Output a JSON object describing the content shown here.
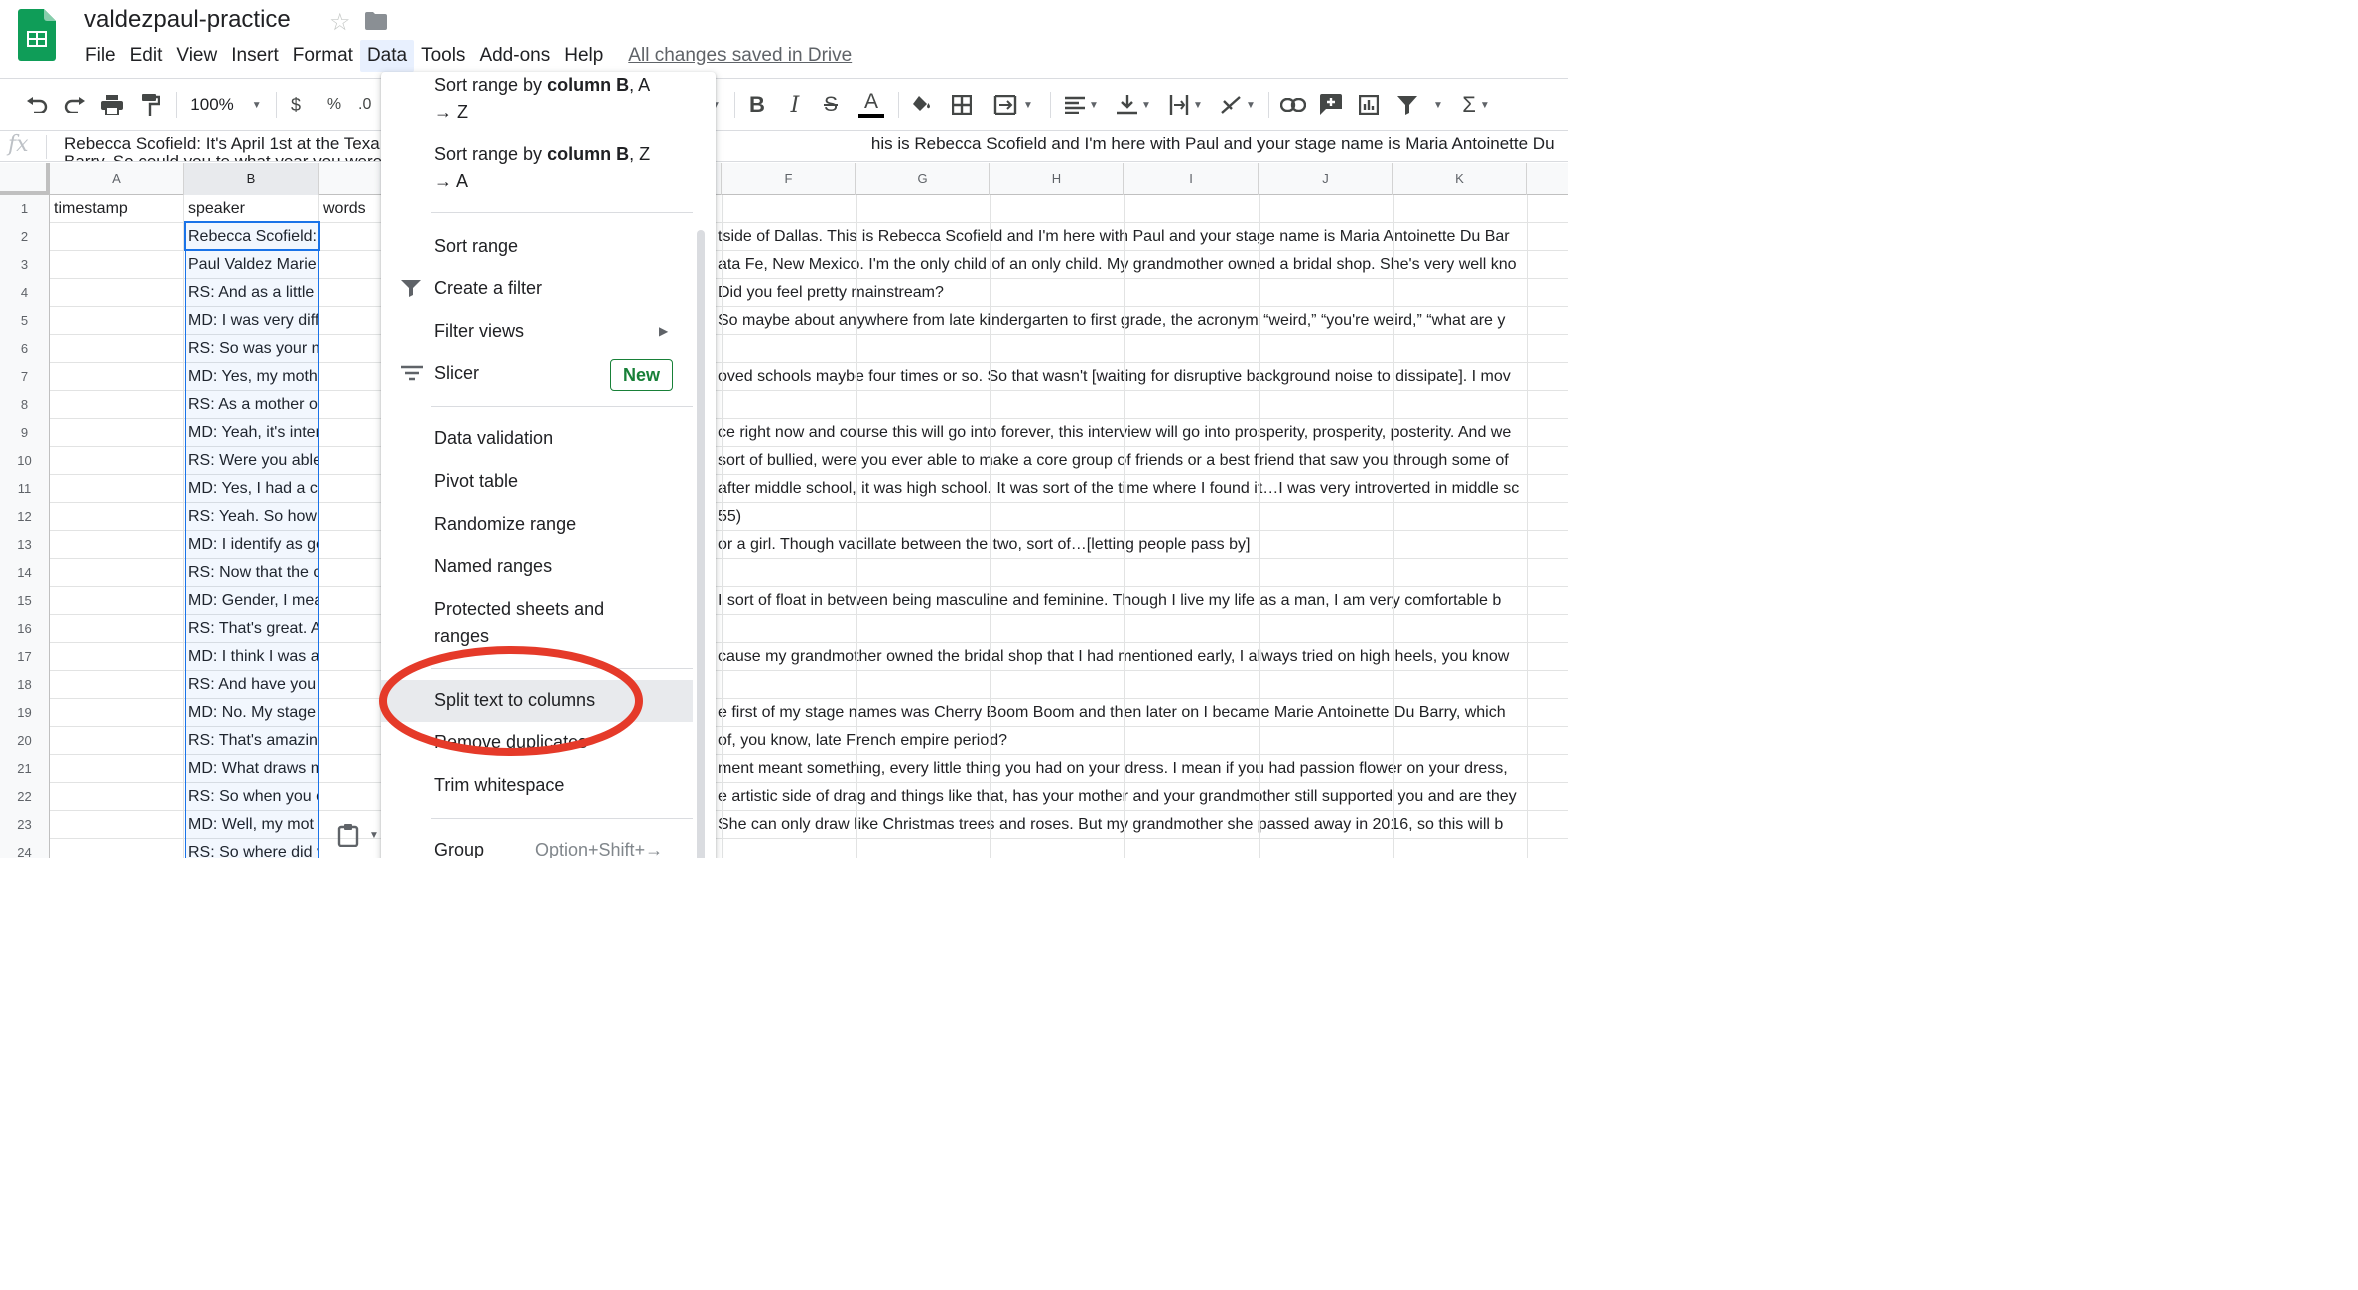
{
  "app": {
    "doc_title": "valdezpaul-practice",
    "saved_status": "All changes saved in Drive"
  },
  "menubar": {
    "items": [
      "File",
      "Edit",
      "View",
      "Insert",
      "Format",
      "Data",
      "Tools",
      "Add-ons",
      "Help"
    ],
    "active": "Data"
  },
  "toolbar": {
    "zoom": "100%",
    "currency": "$",
    "percent": "%",
    "decimal": ".0"
  },
  "formula_bar": {
    "fx": "fx",
    "text": "Rebecca Scofield: It's April 1st at the Texa                                                                                                        his is Rebecca Scofield and I'm here with Paul and your stage name is Maria Antoinette Du Barry. So could you te what year you were born?"
  },
  "columns": [
    "A",
    "B",
    "C",
    "D",
    "E",
    "F",
    "G",
    "H",
    "I",
    "J",
    "K"
  ],
  "rows": [
    {
      "n": "1",
      "a": "timestamp",
      "b": "speaker",
      "c": "words",
      "right": ""
    },
    {
      "n": "2",
      "a": "",
      "b": "Rebecca Scofield: It's Ap",
      "c": "",
      "right": "tside of Dallas. This is Rebecca Scofield and I'm here with Paul and your stage name is Maria Antoinette Du Bar"
    },
    {
      "n": "3",
      "a": "",
      "b": "Paul Valdez Marie Du Ba",
      "c": "",
      "right": "ata Fe, New Mexico. I'm the only child of an only child. My grandmother owned a bridal shop. She's very well kno"
    },
    {
      "n": "4",
      "a": "",
      "b": "RS: And as a little kid, dic",
      "c": "",
      "right": "Did you feel pretty mainstream?"
    },
    {
      "n": "5",
      "a": "",
      "b": "MD: I was very different. I",
      "c": "",
      "right": "So maybe about anywhere from late kindergarten to first grade, the acronym “weird,” “you're weird,” “what are y"
    },
    {
      "n": "6",
      "a": "",
      "b": "RS: So was your mom pr",
      "c": "",
      "right": ""
    },
    {
      "n": "7",
      "a": "",
      "b": "MD: Yes, my mother was",
      "c": "",
      "right": "oved schools maybe four times or so. So that wasn't [waiting for disruptive background noise to dissipate]. I mov"
    },
    {
      "n": "8",
      "a": "",
      "b": "RS: As a mother of a son",
      "c": "",
      "right": ""
    },
    {
      "n": "9",
      "a": "",
      "b": "MD: Yeah, it's intense. Ar",
      "c": "",
      "right": "ce right now and course this will go into forever, this interview will go into prosperity, prosperity, posterity. And we"
    },
    {
      "n": "10",
      "a": "",
      "b": "RS: Were you able to, ev",
      "c": "",
      "right": "sort of bullied, were you ever able to make a core group of friends or a best friend that saw you through some of"
    },
    {
      "n": "11",
      "a": "",
      "b": "MD: Yes, I had a couple,",
      "c": "",
      "right": "after middle school, it was high school. It was sort of the time where I found it…I was very introverted in middle sc"
    },
    {
      "n": "12",
      "a": "",
      "b": "RS: Yeah. So how do you",
      "c": "",
      "right": "55)"
    },
    {
      "n": "13",
      "a": "",
      "b": "MD: I identify as gender-f",
      "c": "",
      "right": "or a girl. Though vacillate between the two, sort of…[letting people pass by]"
    },
    {
      "n": "14",
      "a": "",
      "b": "RS: Now that the chatty C",
      "c": "",
      "right": ""
    },
    {
      "n": "15",
      "a": "",
      "b": "MD:  Gender, I mean I ide",
      "c": "",
      "right": "I sort of float in between being masculine and feminine. Though I live my life as a man, I am very comfortable b"
    },
    {
      "n": "16",
      "a": "",
      "b": "RS: That's great. And wh",
      "c": "",
      "right": ""
    },
    {
      "n": "17",
      "a": "",
      "b": "MD: I think I was always c",
      "c": "",
      "right": "cause my grandmother owned the bridal shop that I had mentioned early, I always tried on high heels, you know"
    },
    {
      "n": "18",
      "a": "",
      "b": "RS: And have you always",
      "c": "",
      "right": ""
    },
    {
      "n": "19",
      "a": "",
      "b": "MD: No. My stage name",
      "c": "",
      "right": "e first of my stage names was Cherry Boom Boom and then later on I became Marie Antoinette Du Barry, which"
    },
    {
      "n": "20",
      "a": "",
      "b": "RS: That's amazing. Wha",
      "c": "",
      "right": "of, you know, late French empire period?"
    },
    {
      "n": "21",
      "a": "",
      "b": "MD: What draws me is th",
      "c": "",
      "right": "ment meant something, every little thing you had on your dress. I mean if you had passion flower on your dress,"
    },
    {
      "n": "22",
      "a": "",
      "b": "RS: So when you officially",
      "c": "",
      "right": "e artistic side of drag and things like that, has your mother and your grandmother still supported you and are they"
    },
    {
      "n": "23",
      "a": "",
      "b": "MD: Well, my mot",
      "c": "",
      "right": "She can only draw like Christmas trees and roses. But my grandmother she passed away in 2016, so this will b"
    },
    {
      "n": "24",
      "a": "",
      "b": "RS: So where did you st",
      "c": "",
      "right": ""
    }
  ],
  "data_menu": {
    "sort_az": [
      "Sort range by ",
      "column B",
      ", A",
      "→ Z"
    ],
    "sort_za": [
      "Sort range by ",
      "column B",
      ", Z",
      "→ A"
    ],
    "sort_range": "Sort range",
    "create_filter": "Create a filter",
    "filter_views": "Filter views",
    "slicer": "Slicer",
    "new_badge": "New",
    "data_validation": "Data validation",
    "pivot_table": "Pivot table",
    "randomize_range": "Randomize range",
    "named_ranges": "Named ranges",
    "protected_line1": "Protected sheets and",
    "protected_line2": "ranges",
    "split_text": "Split text to columns",
    "remove_duplicates": "Remove duplicates",
    "trim_whitespace": "Trim whitespace",
    "group": "Group",
    "group_shortcut": "Option+Shift+→"
  },
  "colors": {
    "selection": "#1a73e8",
    "annotation": "#e53a29",
    "new_badge": "#188038",
    "sheets_green": "#0f9d58"
  }
}
